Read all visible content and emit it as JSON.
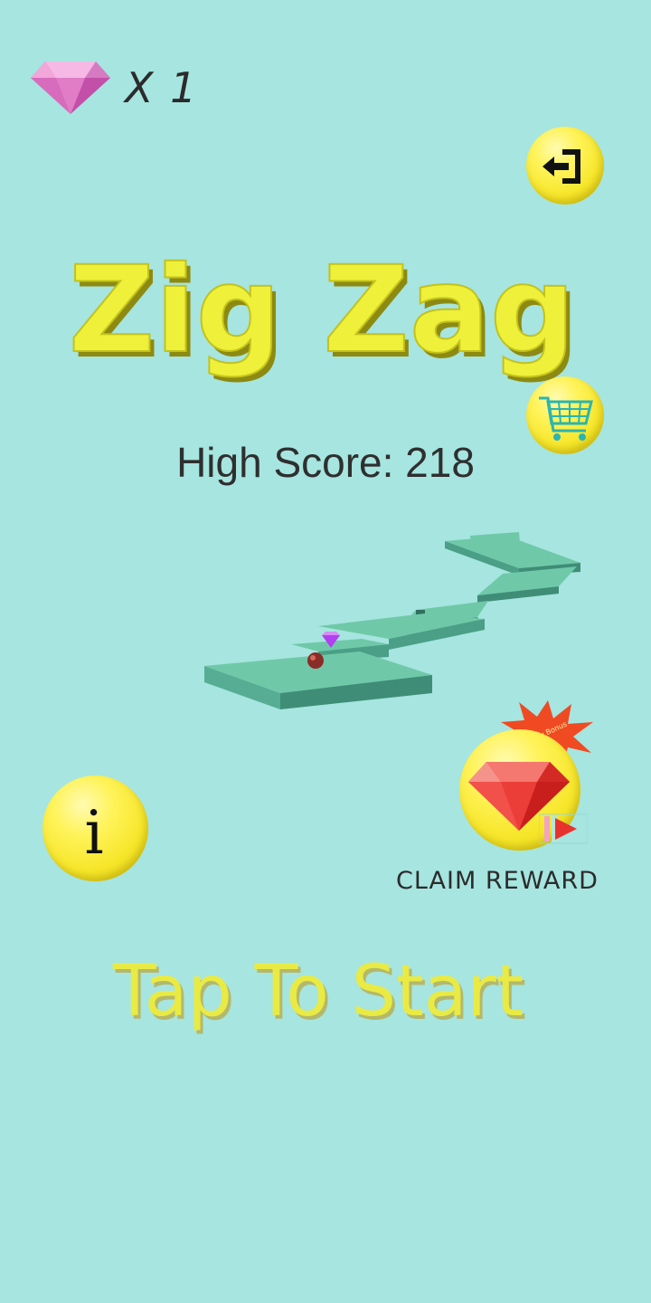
{
  "hud": {
    "gem_icon": "pink-diamond-icon",
    "gem_count_label": "X 1",
    "exit_icon": "exit-arrow-icon",
    "cart_icon": "shopping-cart-icon"
  },
  "title": "Zig Zag",
  "high_score_label": "High Score: 218",
  "info": {
    "icon": "info-icon",
    "glyph": "i"
  },
  "reward": {
    "icon": "red-diamond-icon",
    "badge_text": "Daily Bonus",
    "video_icon": "video-play-icon",
    "label": "CLAIM REWARD"
  },
  "start_prompt": "Tap To Start",
  "colors": {
    "background": "#a6e5e0",
    "button_yellow": "#f6e629",
    "title_yellow": "#eef03a",
    "path_top": "#6fc9a8",
    "path_side": "#4a9f86",
    "ball": "#8a2c28",
    "gem_pink": "#e58fcf",
    "gem_purple": "#b040f0",
    "gem_red": "#e8322e",
    "burst": "#f04a22"
  }
}
